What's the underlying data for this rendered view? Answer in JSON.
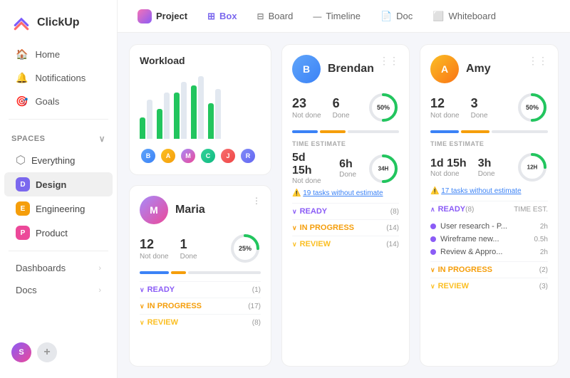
{
  "logo": {
    "text": "ClickUp"
  },
  "sidebar": {
    "nav": [
      {
        "id": "home",
        "label": "Home",
        "icon": "🏠"
      },
      {
        "id": "notifications",
        "label": "Notifications",
        "icon": "🔔"
      },
      {
        "id": "goals",
        "label": "Goals",
        "icon": "🎯"
      }
    ],
    "spaces_label": "Spaces",
    "spaces": [
      {
        "id": "everything",
        "label": "Everything",
        "icon": "⬡",
        "type": "icon"
      },
      {
        "id": "design",
        "label": "Design",
        "letter": "D",
        "color": "dot-d"
      },
      {
        "id": "engineering",
        "label": "Engineering",
        "letter": "E",
        "color": "dot-e"
      },
      {
        "id": "product",
        "label": "Product",
        "letter": "P",
        "color": "dot-p"
      }
    ],
    "bottom": [
      {
        "id": "dashboards",
        "label": "Dashboards"
      },
      {
        "id": "docs",
        "label": "Docs"
      }
    ]
  },
  "topnav": {
    "project_label": "Project",
    "tabs": [
      {
        "id": "box",
        "label": "Box",
        "icon": "⊞",
        "active": true
      },
      {
        "id": "board",
        "label": "Board",
        "icon": "▦"
      },
      {
        "id": "timeline",
        "label": "Timeline",
        "icon": "—"
      },
      {
        "id": "doc",
        "label": "Doc",
        "icon": "📄"
      },
      {
        "id": "whiteboard",
        "label": "Whiteboard",
        "icon": "⬜"
      }
    ]
  },
  "workload": {
    "title": "Workload",
    "bars": [
      {
        "green": 30,
        "gray": 60
      },
      {
        "green": 45,
        "gray": 70
      },
      {
        "green": 70,
        "gray": 85
      },
      {
        "green": 80,
        "gray": 90
      },
      {
        "green": 55,
        "gray": 75
      }
    ],
    "avatars": [
      "B",
      "A",
      "M",
      "C",
      "J",
      "R"
    ]
  },
  "brendan": {
    "name": "Brendan",
    "not_done": 23,
    "not_done_label": "Not done",
    "done": 6,
    "done_label": "Done",
    "percent": 50,
    "time_estimate_label": "TIME ESTIMATE",
    "time_not_done": "5d 15h",
    "time_not_done_label": "Not done",
    "time_done": "6h",
    "time_done_label": "Done",
    "time_circle": "34H",
    "warning": "19 tasks without estimate",
    "ready_label": "READY",
    "ready_count": "(8)",
    "in_progress_label": "IN PROGRESS",
    "in_progress_count": "(14)",
    "review_label": "REVIEW",
    "review_count": "(14)"
  },
  "amy": {
    "name": "Amy",
    "not_done": 12,
    "not_done_label": "Not done",
    "done": 3,
    "done_label": "Done",
    "percent": 50,
    "time_estimate_label": "TIME ESTIMATE",
    "time_not_done": "1d 15h",
    "time_not_done_label": "Not done",
    "time_done": "3h",
    "time_done_label": "Done",
    "time_circle": "12H",
    "warning": "17 tasks without estimate",
    "ready_label": "READY",
    "ready_count": "(8)",
    "time_est_col": "TIME EST.",
    "tasks": [
      {
        "name": "User research - P...",
        "time": "2h"
      },
      {
        "name": "Wireframe new...",
        "time": "0.5h"
      },
      {
        "name": "Review & Appro...",
        "time": "2h"
      }
    ],
    "in_progress_label": "IN PROGRESS",
    "in_progress_count": "(2)",
    "review_label": "REVIEW",
    "review_count": "(3)"
  },
  "maria": {
    "name": "Maria",
    "not_done": 12,
    "not_done_label": "Not done",
    "done": 1,
    "done_label": "Done",
    "percent": 25,
    "ready_label": "READY",
    "ready_count": "(1)",
    "in_progress_label": "IN PROGRESS",
    "in_progress_count": "(17)",
    "review_label": "REVIEW",
    "review_count": "(8)"
  }
}
